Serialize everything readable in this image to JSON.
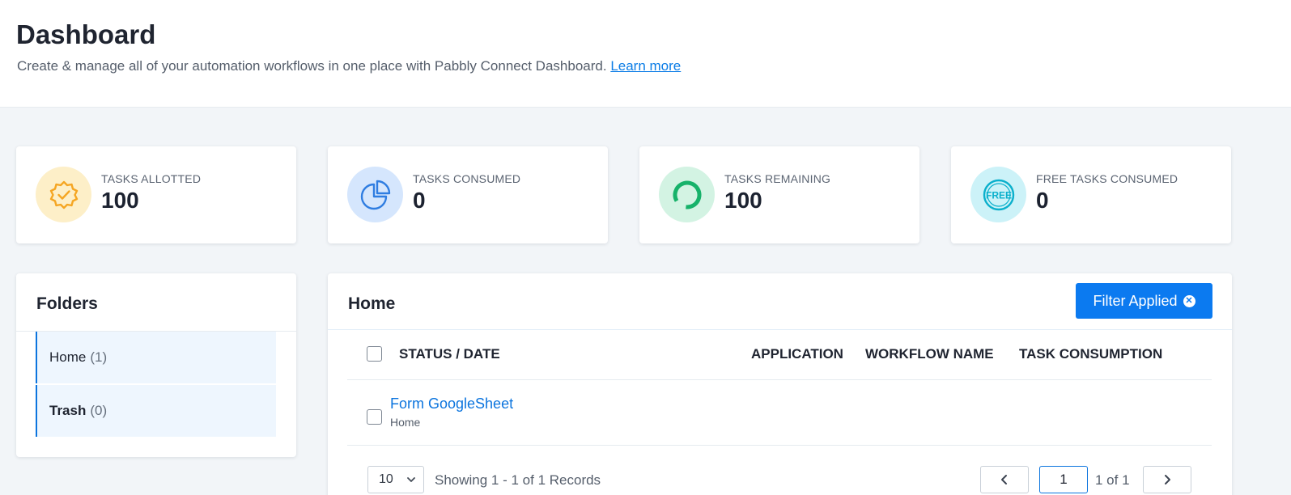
{
  "header": {
    "title": "Dashboard",
    "subtitle": "Create & manage all of your automation workflows in one place with Pabbly Connect Dashboard.",
    "learn_more": "Learn more"
  },
  "stats": [
    {
      "label": "TASKS ALLOTTED",
      "value": "100",
      "icon": "badge-check-icon",
      "icon_bg": "#fdefc8",
      "icon_color": "#f5a623"
    },
    {
      "label": "TASKS CONSUMED",
      "value": "0",
      "icon": "pie-chart-icon",
      "icon_bg": "#d5e6fd",
      "icon_color": "#2f7de1"
    },
    {
      "label": "TASKS REMAINING",
      "value": "100",
      "icon": "donut-chart-icon",
      "icon_bg": "#d3f3e3",
      "icon_color": "#17b26a"
    },
    {
      "label": "FREE TASKS CONSUMED",
      "value": "0",
      "icon": "free-badge-icon",
      "icon_bg": "#ccf2f8",
      "icon_color": "#0bb0cc"
    }
  ],
  "folders": {
    "title": "Folders",
    "items": [
      {
        "name": "Home",
        "count": "(1)"
      },
      {
        "name": "Trash",
        "count": "(0)"
      }
    ]
  },
  "main": {
    "title": "Home",
    "filter_button": "Filter Applied",
    "columns": [
      "STATUS / DATE",
      "APPLICATION",
      "WORKFLOW NAME",
      "TASK CONSUMPTION"
    ],
    "rows": [
      {
        "name": "Form GoogleSheet",
        "folder": "Home"
      }
    ],
    "pagination": {
      "per_page": "10",
      "showing": "Showing 1 - 1 of 1 Records",
      "current_page": "1",
      "page_of": "1 of 1"
    }
  },
  "colors": {
    "accent": "#0b7af0",
    "background": "#f2f5f8"
  }
}
